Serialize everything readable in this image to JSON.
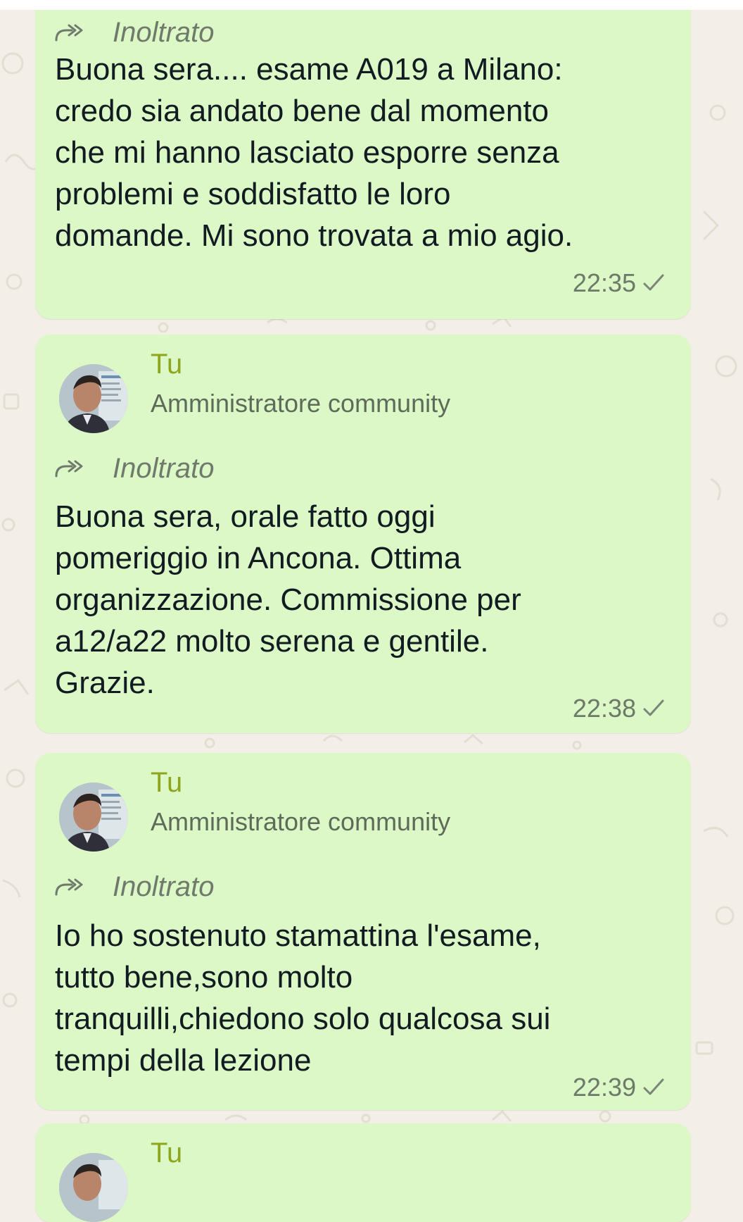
{
  "chat": {
    "messages": [
      {
        "forwarded_label": "Inoltrato",
        "text": "Buona sera.... esame A019 a Milano:\ncredo sia andato bene dal momento\nche mi hanno lasciato esporre senza\nproblemi e soddisfatto le loro\ndomande. Mi sono trovata a mio agio.",
        "time": "22:35",
        "status_icon": "single-check-icon"
      },
      {
        "sender": "Tu",
        "role": "Amministratore community",
        "forwarded_label": "Inoltrato",
        "text": "Buona sera, orale fatto oggi\npomeriggio in Ancona. Ottima\norganizzazione. Commissione per\na12/a22 molto serena e gentile.\nGrazie.",
        "time": "22:38",
        "status_icon": "single-check-icon"
      },
      {
        "sender": "Tu",
        "role": "Amministratore community",
        "forwarded_label": "Inoltrato",
        "text": "Io ho sostenuto stamattina l'esame,\ntutto bene,sono molto\ntranquilli,chiedono solo qualcosa sui\ntempi della lezione",
        "time": "22:39",
        "status_icon": "single-check-icon"
      },
      {
        "sender": "Tu"
      }
    ]
  },
  "colors": {
    "bubble": "#dcf8c6",
    "sender_name": "#8fa51d",
    "wallpaper": "#f3efe8",
    "meta_text": "#6d7a6a"
  }
}
